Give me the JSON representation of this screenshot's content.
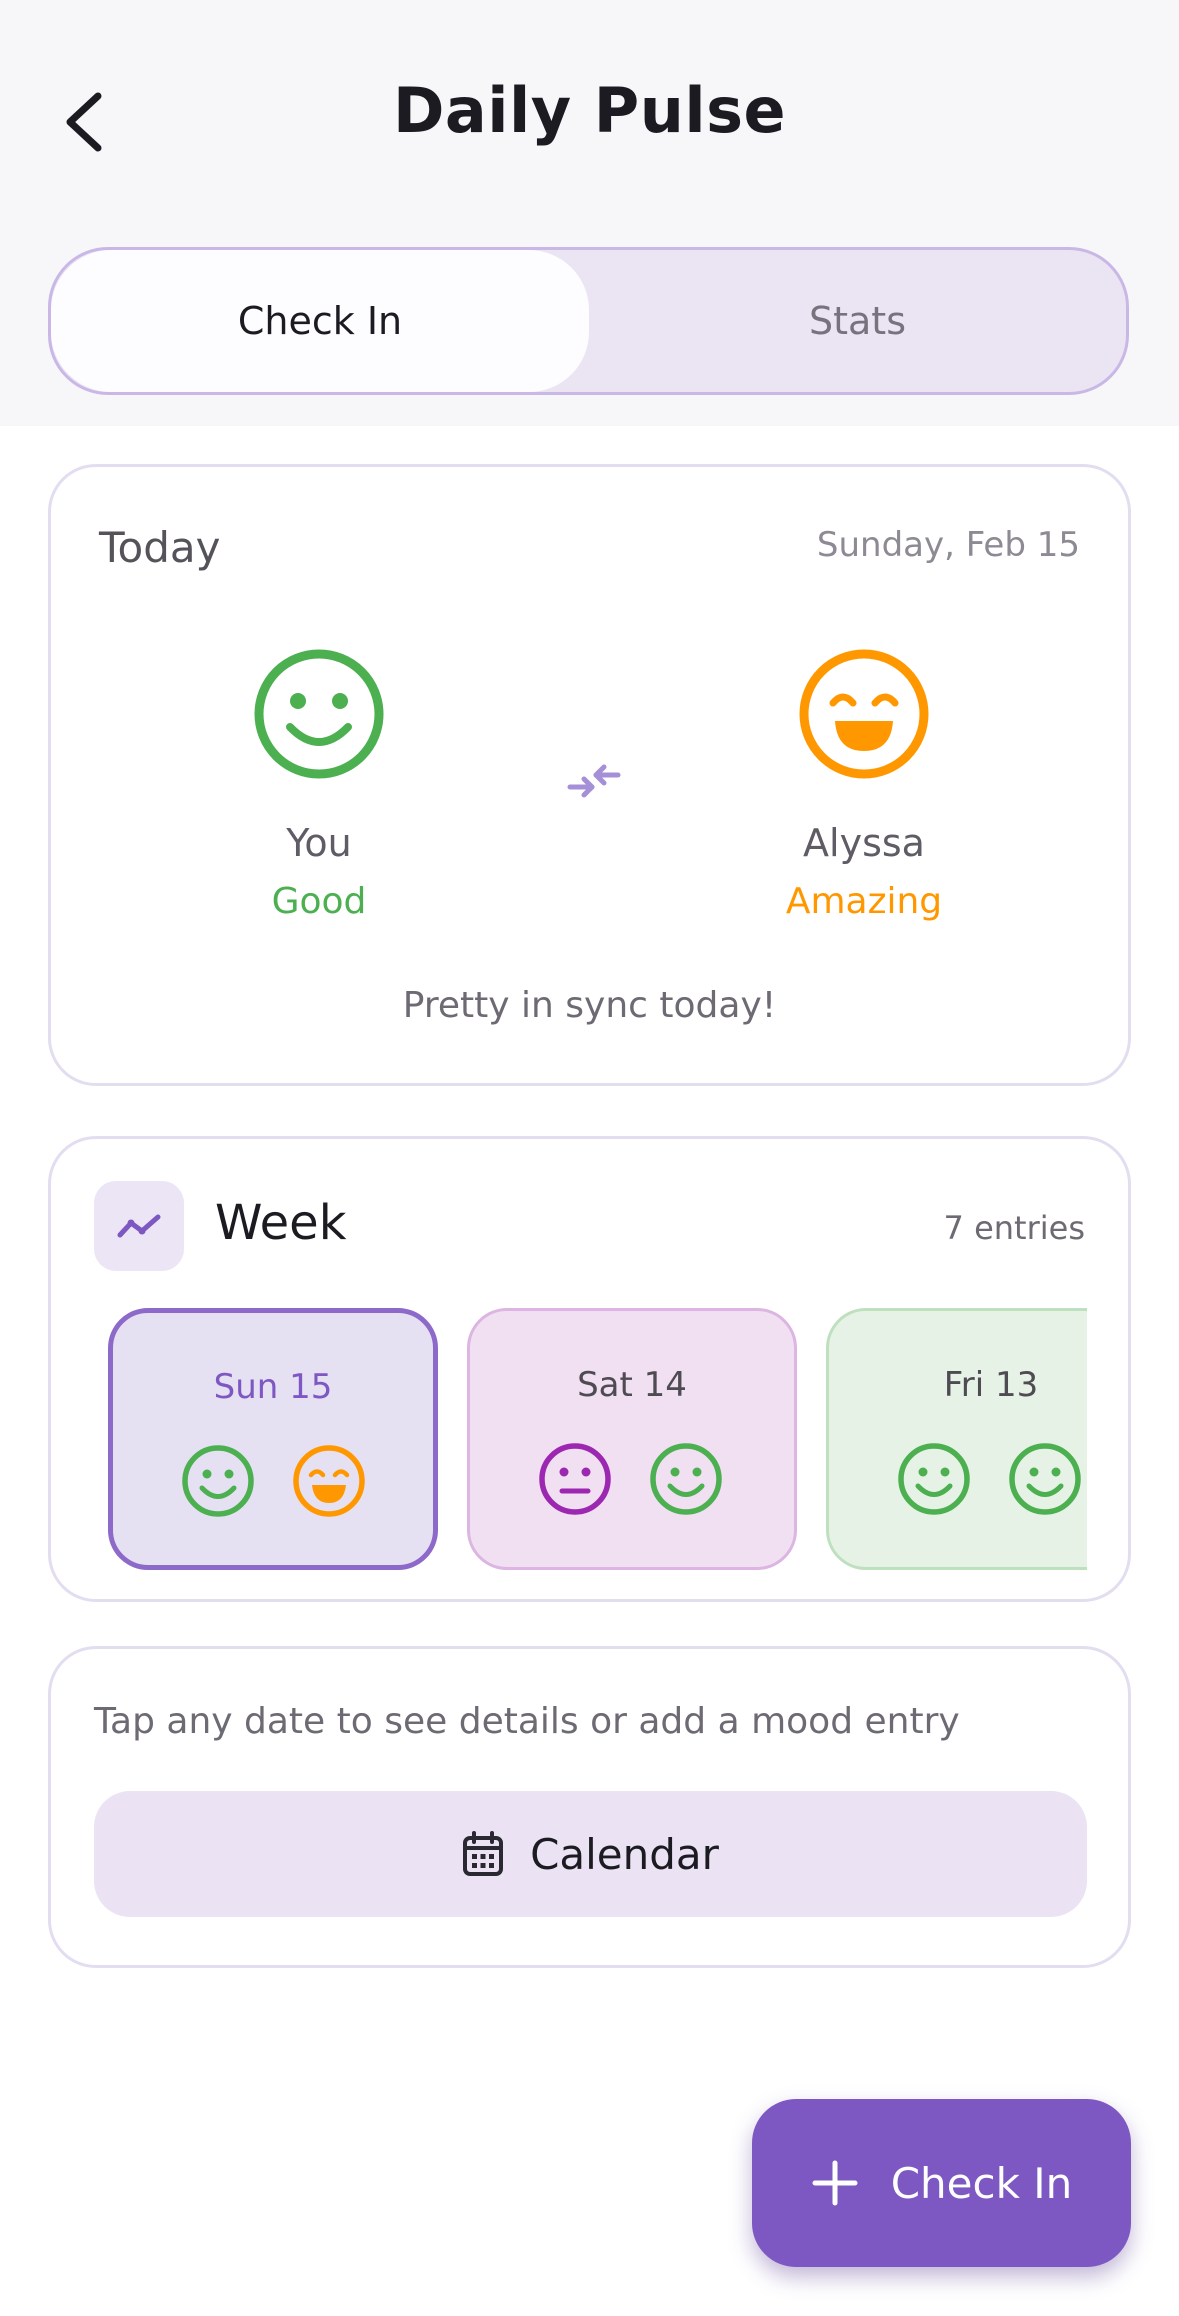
{
  "header": {
    "title": "Daily Pulse",
    "back_icon": "chevron-left-icon"
  },
  "tabs": [
    {
      "label": "Check In",
      "active": true
    },
    {
      "label": "Stats",
      "active": false
    }
  ],
  "today": {
    "label": "Today",
    "date": "Sunday, Feb 15",
    "you": {
      "name": "You",
      "mood": "Good",
      "color": "#4caf50",
      "icon": "smile-face-icon"
    },
    "partner": {
      "name": "Alyssa",
      "mood": "Amazing",
      "color": "#ff9800",
      "icon": "grin-face-icon"
    },
    "sync_icon": "arrows-converge-icon",
    "sync_message": "Pretty in sync today!"
  },
  "week": {
    "title": "Week",
    "count": "7 entries",
    "icon": "trend-line-icon",
    "days": [
      {
        "label": "Sun 15",
        "selected": true,
        "faces": [
          "smile",
          "grin"
        ],
        "face_colors": [
          "#4caf50",
          "#ff9800"
        ]
      },
      {
        "label": "Sat 14",
        "selected": false,
        "faces": [
          "neutral",
          "smile"
        ],
        "face_colors": [
          "#9c27b0",
          "#4caf50"
        ]
      },
      {
        "label": "Fri 13",
        "selected": false,
        "faces": [
          "smile",
          "smile"
        ],
        "face_colors": [
          "#4caf50",
          "#4caf50"
        ]
      }
    ]
  },
  "calendar": {
    "hint": "Tap any date to see details or add a mood entry",
    "button_label": "Calendar",
    "icon": "calendar-icon"
  },
  "fab": {
    "label": "Check In",
    "icon": "plus-icon"
  },
  "colors": {
    "accent": "#7d57c2",
    "good": "#4caf50",
    "amazing": "#ff9800",
    "meh": "#9c27b0"
  }
}
